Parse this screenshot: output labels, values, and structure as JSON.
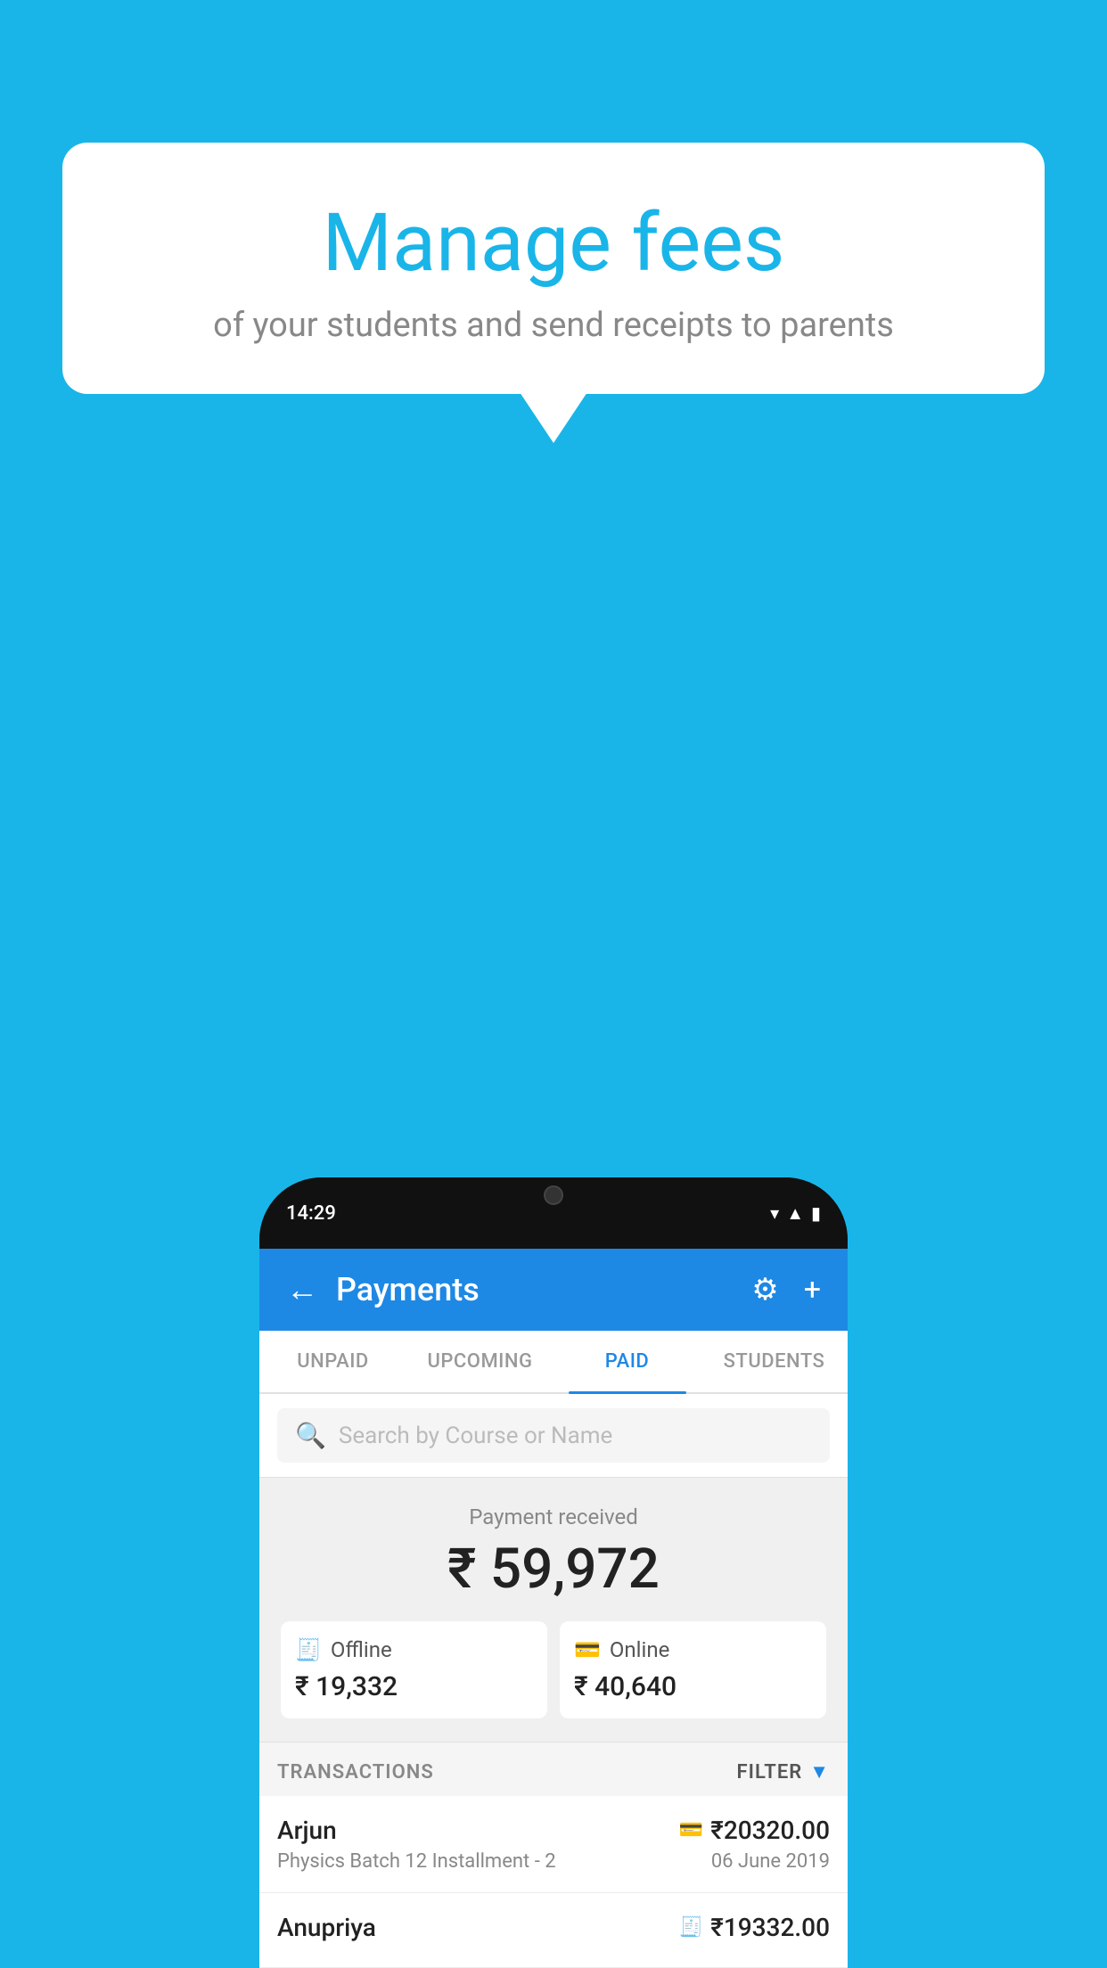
{
  "background_color": "#1ab5e8",
  "bubble": {
    "title": "Manage fees",
    "subtitle": "of your students and send receipts to parents"
  },
  "phone": {
    "status_time": "14:29",
    "header": {
      "title": "Payments",
      "back_label": "←",
      "settings_label": "⚙",
      "add_label": "+"
    },
    "tabs": [
      {
        "label": "UNPAID",
        "active": false
      },
      {
        "label": "UPCOMING",
        "active": false
      },
      {
        "label": "PAID",
        "active": true
      },
      {
        "label": "STUDENTS",
        "active": false
      }
    ],
    "search": {
      "placeholder": "Search by Course or Name"
    },
    "payment_summary": {
      "label": "Payment received",
      "total": "₹ 59,972",
      "offline_label": "Offline",
      "offline_amount": "₹ 19,332",
      "online_label": "Online",
      "online_amount": "₹ 40,640"
    },
    "transactions": {
      "section_label": "TRANSACTIONS",
      "filter_label": "FILTER",
      "items": [
        {
          "name": "Arjun",
          "course": "Physics Batch 12 Installment - 2",
          "amount": "₹20320.00",
          "date": "06 June 2019",
          "payment_type": "online"
        },
        {
          "name": "Anupriya",
          "course": "",
          "amount": "₹19332.00",
          "date": "",
          "payment_type": "offline"
        }
      ]
    }
  }
}
